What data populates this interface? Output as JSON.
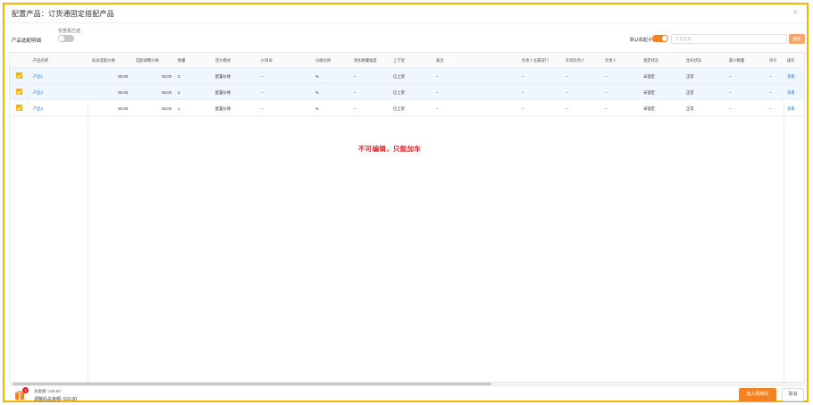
{
  "dialog": {
    "title": "配置产品：订货通固定搭配产品",
    "close_glyph": "×"
  },
  "toolbar": {
    "detail_label": "产品选配明细",
    "only_selected_label": "仅查看已选",
    "only_selected_on": false,
    "default_collapse_label": "默认收起子级",
    "default_collapse_on": true,
    "search_placeholder": "产品名称",
    "search_button": "搜索"
  },
  "table": {
    "columns": [
      "产品名称",
      "标准选配价格",
      "选配调整价格",
      "数量",
      "定价模式",
      "价目表",
      "分摊比例",
      "增加数量幅度",
      "上下架",
      "备注",
      "负责人主属部门",
      "外部负责人",
      "负责人",
      "锁定状态",
      "生命状态",
      "最小数量",
      "序号",
      "操作"
    ],
    "rows": [
      {
        "selected": true,
        "name": "产品1",
        "std_price": "80.00",
        "adj_price": "80.00",
        "qty": "3",
        "pricing": "配置价格",
        "pricebook": "--",
        "ratio": "%",
        "inc": "--",
        "shelf": "已上架",
        "remark": "--",
        "dept": "--",
        "ext_owner": "--",
        "owner": "--",
        "lock": "未锁定",
        "life": "正常",
        "min_qty": "--",
        "seq": "--",
        "action": "查看"
      },
      {
        "selected": true,
        "name": "产品2",
        "std_price": "60.00",
        "adj_price": "60.00",
        "qty": "2",
        "pricing": "配置价格",
        "pricebook": "--",
        "ratio": "%",
        "inc": "--",
        "shelf": "已上架",
        "remark": "--",
        "dept": "--",
        "ext_owner": "--",
        "owner": "--",
        "lock": "未锁定",
        "life": "正常",
        "min_qty": "--",
        "seq": "--",
        "action": "查看"
      },
      {
        "selected": true,
        "name": "产品3",
        "std_price": "50.00",
        "adj_price": "50.00",
        "qty": "1",
        "pricing": "配置价格",
        "pricebook": "--",
        "ratio": "%",
        "inc": "--",
        "shelf": "已上架",
        "remark": "--",
        "dept": "--",
        "ext_owner": "--",
        "owner": "--",
        "lock": "未锁定",
        "life": "正常",
        "min_qty": "--",
        "seq": "--",
        "action": "查看"
      }
    ]
  },
  "notice": "不可编辑，只能加车",
  "footer": {
    "cart_count": "3",
    "total_label": "总金额: 100.00",
    "adjusted_total_label": "调整后总金额: 510.00",
    "add_to_cart": "加入购物车",
    "cancel": "取消"
  },
  "colors": {
    "accent": "#f58220",
    "border_highlight": "#f5b300",
    "link": "#2f7fd8",
    "notice": "#e02424"
  }
}
